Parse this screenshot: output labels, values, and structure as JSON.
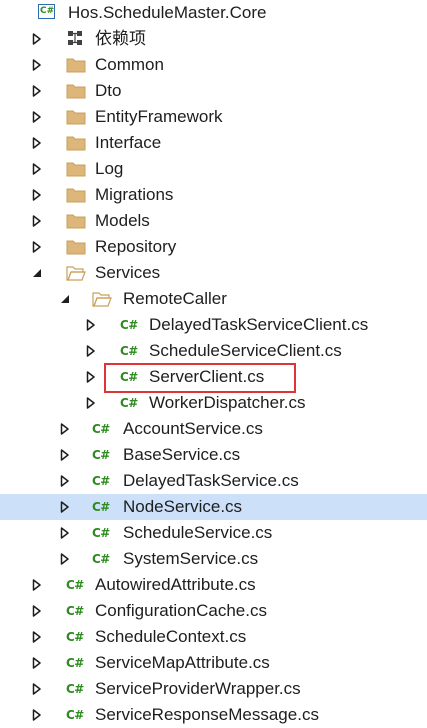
{
  "tree": {
    "items": [
      {
        "label": "Hos.ScheduleMaster.Core",
        "icon": "csharp-project-icon",
        "level": 0,
        "expander": "none"
      },
      {
        "label": "依赖项",
        "icon": "dependencies-icon",
        "level": 1,
        "expander": "collapsed"
      },
      {
        "label": "Common",
        "icon": "folder-icon",
        "level": 1,
        "expander": "collapsed"
      },
      {
        "label": "Dto",
        "icon": "folder-icon",
        "level": 1,
        "expander": "collapsed"
      },
      {
        "label": "EntityFramework",
        "icon": "folder-icon",
        "level": 1,
        "expander": "collapsed"
      },
      {
        "label": "Interface",
        "icon": "folder-icon",
        "level": 1,
        "expander": "collapsed"
      },
      {
        "label": "Log",
        "icon": "folder-icon",
        "level": 1,
        "expander": "collapsed"
      },
      {
        "label": "Migrations",
        "icon": "folder-icon",
        "level": 1,
        "expander": "collapsed"
      },
      {
        "label": "Models",
        "icon": "folder-icon",
        "level": 1,
        "expander": "collapsed"
      },
      {
        "label": "Repository",
        "icon": "folder-icon",
        "level": 1,
        "expander": "collapsed"
      },
      {
        "label": "Services",
        "icon": "folder-open-icon",
        "level": 1,
        "expander": "expanded"
      },
      {
        "label": "RemoteCaller",
        "icon": "folder-open-icon",
        "level": 2,
        "expander": "expanded"
      },
      {
        "label": "DelayedTaskServiceClient.cs",
        "icon": "csharp-file-icon",
        "level": 3,
        "expander": "collapsed"
      },
      {
        "label": "ScheduleServiceClient.cs",
        "icon": "csharp-file-icon",
        "level": 3,
        "expander": "collapsed"
      },
      {
        "label": "ServerClient.cs",
        "icon": "csharp-file-icon",
        "level": 3,
        "expander": "collapsed",
        "highlighted": true
      },
      {
        "label": "WorkerDispatcher.cs",
        "icon": "csharp-file-icon",
        "level": 3,
        "expander": "collapsed"
      },
      {
        "label": "AccountService.cs",
        "icon": "csharp-file-icon",
        "level": 2,
        "expander": "collapsed"
      },
      {
        "label": "BaseService.cs",
        "icon": "csharp-file-icon",
        "level": 2,
        "expander": "collapsed"
      },
      {
        "label": "DelayedTaskService.cs",
        "icon": "csharp-file-icon",
        "level": 2,
        "expander": "collapsed"
      },
      {
        "label": "NodeService.cs",
        "icon": "csharp-file-icon",
        "level": 2,
        "expander": "collapsed",
        "selected": true
      },
      {
        "label": "ScheduleService.cs",
        "icon": "csharp-file-icon",
        "level": 2,
        "expander": "collapsed"
      },
      {
        "label": "SystemService.cs",
        "icon": "csharp-file-icon",
        "level": 2,
        "expander": "collapsed"
      },
      {
        "label": "AutowiredAttribute.cs",
        "icon": "csharp-file-icon",
        "level": 1,
        "expander": "collapsed"
      },
      {
        "label": "ConfigurationCache.cs",
        "icon": "csharp-file-icon",
        "level": 1,
        "expander": "collapsed"
      },
      {
        "label": "ScheduleContext.cs",
        "icon": "csharp-file-icon",
        "level": 1,
        "expander": "collapsed"
      },
      {
        "label": "ServiceMapAttribute.cs",
        "icon": "csharp-file-icon",
        "level": 1,
        "expander": "collapsed"
      },
      {
        "label": "ServiceProviderWrapper.cs",
        "icon": "csharp-file-icon",
        "level": 1,
        "expander": "collapsed"
      },
      {
        "label": "ServiceResponseMessage.cs",
        "icon": "csharp-file-icon",
        "level": 1,
        "expander": "collapsed"
      }
    ]
  },
  "colors": {
    "selection": "#cce0fa",
    "highlight_border": "#e03434",
    "folder": "#dcb67a",
    "csharp_glyph": "#2d8b1f"
  }
}
